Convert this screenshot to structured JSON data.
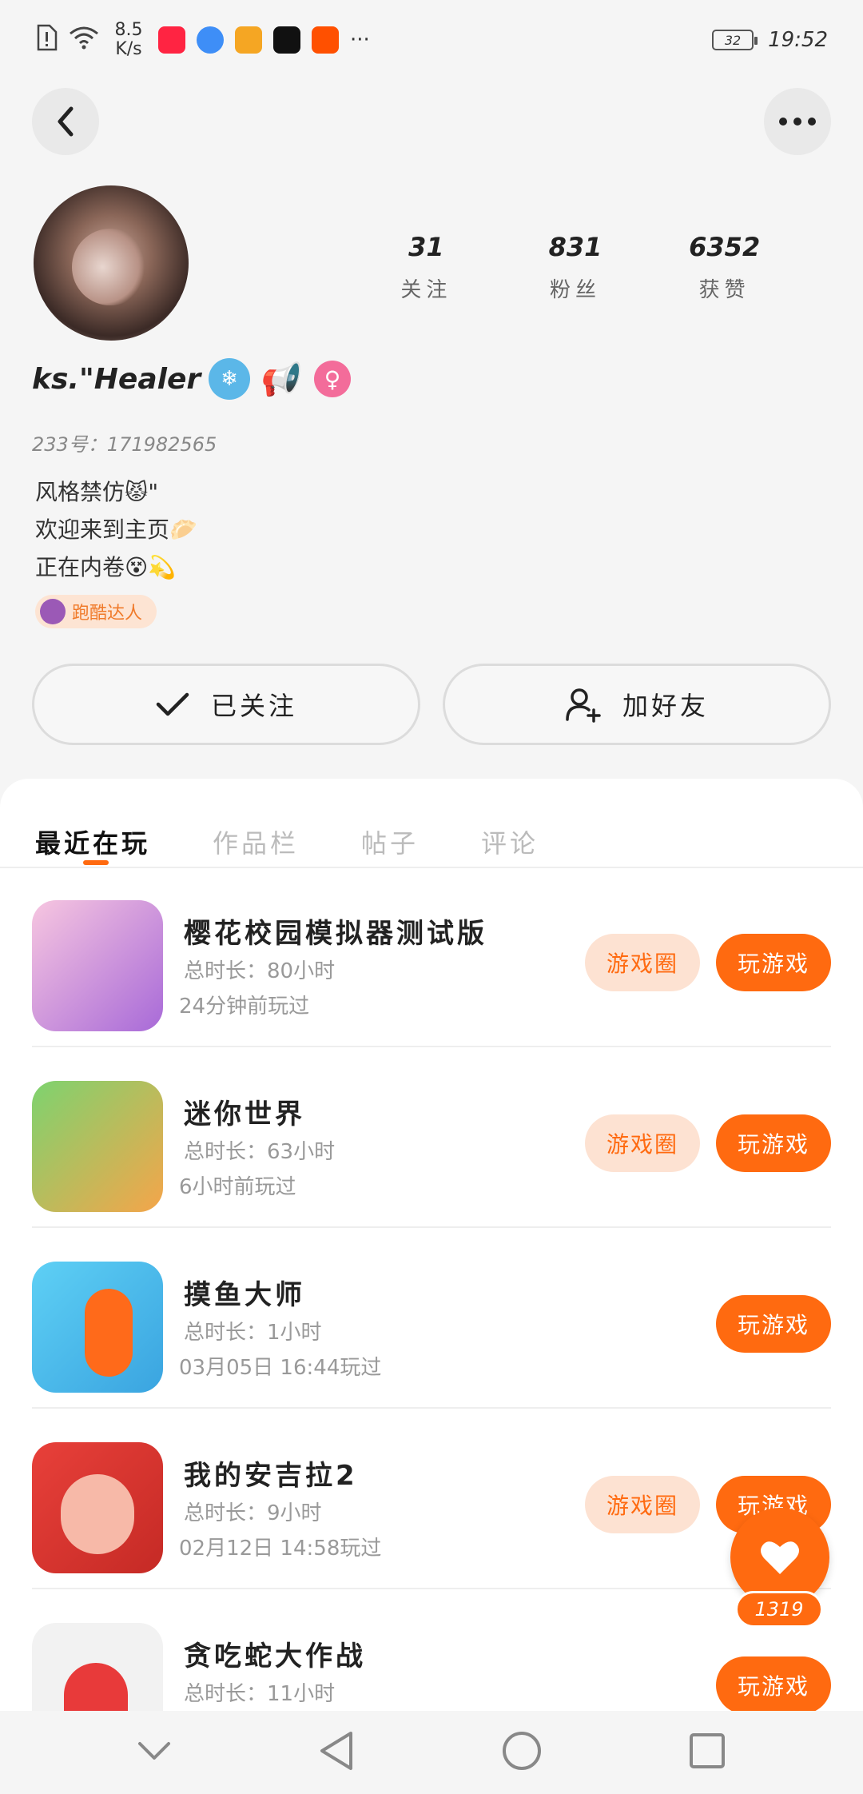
{
  "status_bar": {
    "net_speed": "8.5 K/s",
    "battery": "32",
    "time": "19:52",
    "more": "···",
    "app_icons": [
      {
        "name": "xiaohongshu-icon",
        "color": "#ff2442",
        "label": "小红书"
      },
      {
        "name": "browser-icon",
        "color": "#3e8ef7"
      },
      {
        "name": "orange-app-icon",
        "color": "#f5a623"
      },
      {
        "name": "video-app-icon",
        "color": "#111111"
      },
      {
        "name": "taobao-icon",
        "color": "#ff5000"
      }
    ]
  },
  "profile": {
    "username": "ks.\"Healer",
    "id_text": "233号：171982565",
    "stats": [
      {
        "value": "31",
        "label": "关注"
      },
      {
        "value": "831",
        "label": "粉丝"
      },
      {
        "value": "6352",
        "label": "获赞"
      }
    ],
    "bio_lines": [
      "风格禁仿😾\"",
      "欢迎来到主页🥟",
      "正在内卷😵💫"
    ],
    "badge": "跑酷达人"
  },
  "actions": {
    "followed": "已关注",
    "add_friend": "加好友"
  },
  "tabs": [
    "最近在玩",
    "作品栏",
    "帖子",
    "评论"
  ],
  "games": [
    {
      "title": "樱花校园模拟器测试版",
      "total": "总时长：80小时",
      "last": "24分钟前玩过",
      "has_circle": true,
      "icon_colors": [
        "#f7c6e0",
        "#a86ad8"
      ]
    },
    {
      "title": "迷你世界",
      "total": "总时长：63小时",
      "last": "6小时前玩过",
      "has_circle": true,
      "icon_colors": [
        "#7dd36f",
        "#f5a54a"
      ]
    },
    {
      "title": "摸鱼大师",
      "total": "总时长：1小时",
      "last": "03月05日 16:44玩过",
      "has_circle": false,
      "icon_colors": [
        "#5ed0f5",
        "#ff6a1a"
      ]
    },
    {
      "title": "我的安吉拉2",
      "total": "总时长：9小时",
      "last": "02月12日 14:58玩过",
      "has_circle": true,
      "icon_colors": [
        "#e8403a",
        "#f7b9a8"
      ]
    },
    {
      "title": "贪吃蛇大作战",
      "total": "总时长：11小时",
      "last": "",
      "has_circle": false,
      "icon_colors": [
        "#f2f2f2",
        "#e83a3a"
      ]
    }
  ],
  "buttons": {
    "circle": "游戏圈",
    "play": "玩游戏"
  },
  "float": {
    "count": "1319"
  },
  "colors": {
    "accent": "#ff6a10",
    "accent_light": "#fde2d2"
  }
}
